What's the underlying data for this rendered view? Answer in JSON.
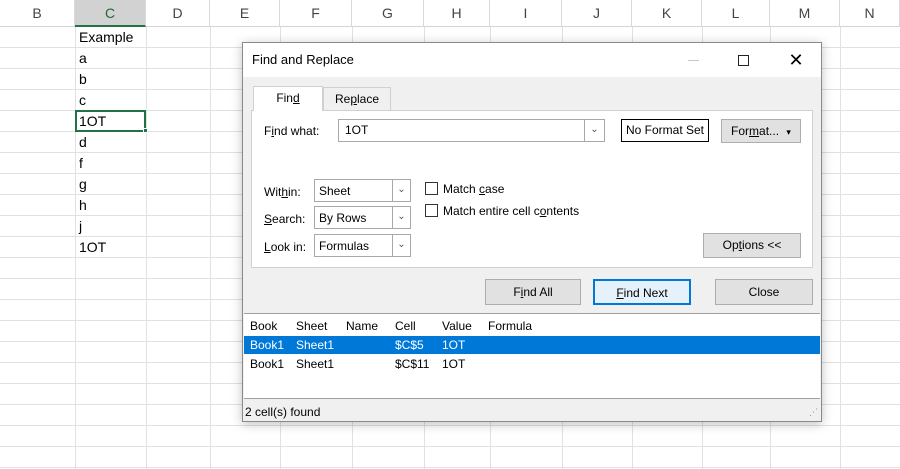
{
  "sheet": {
    "columns": [
      "B",
      "C",
      "D",
      "E",
      "F",
      "G",
      "H",
      "I",
      "J",
      "K",
      "L",
      "M",
      "N"
    ],
    "selected_column": "C",
    "cells": [
      "Example",
      "a",
      "b",
      "c",
      "1OT",
      "d",
      "f",
      "g",
      "h",
      "j",
      "1OT"
    ]
  },
  "dialog": {
    "title": "Find and Replace",
    "tabs": {
      "find": {
        "pre": "Fin",
        "acc": "d",
        "post": ""
      },
      "replace": {
        "pre": "Re",
        "acc": "p",
        "post": "lace"
      }
    },
    "find_what_label": {
      "pre": "F",
      "acc": "i",
      "post": "nd what:"
    },
    "find_what_value": "1OT",
    "no_format_text": "No Format Set",
    "format_button": {
      "pre": "For",
      "acc": "m",
      "post": "at...",
      "arrow": "▾"
    },
    "within": {
      "label_pre": "Wit",
      "label_acc": "h",
      "label_post": "in:",
      "value": "Sheet"
    },
    "search": {
      "label_pre": "",
      "label_acc": "S",
      "label_post": "earch:",
      "value": "By Rows"
    },
    "look_in": {
      "label_pre": "",
      "label_acc": "L",
      "label_post": "ook in:",
      "value": "Formulas"
    },
    "match_case": {
      "pre": "Match ",
      "acc": "c",
      "post": "ase",
      "checked": false
    },
    "match_entire": {
      "pre": "Match entire cell c",
      "acc": "o",
      "post": "ntents",
      "checked": false
    },
    "options_button": {
      "pre": "Op",
      "acc": "t",
      "post": "ions <<"
    },
    "find_all_button": {
      "pre": "F",
      "acc": "i",
      "post": "nd All"
    },
    "find_next_button": {
      "pre": "",
      "acc": "F",
      "post": "ind Next"
    },
    "close_button": "Close",
    "results": {
      "headers": [
        "Book",
        "Sheet",
        "Name",
        "Cell",
        "Value",
        "Formula"
      ],
      "rows": [
        [
          "Book1",
          "Sheet1",
          "",
          "$C$5",
          "1OT",
          ""
        ],
        [
          "Book1",
          "Sheet1",
          "",
          "$C$11",
          "1OT",
          ""
        ]
      ],
      "selected_row": 0
    },
    "status": "2 cell(s) found",
    "icons": {
      "close": "close-icon",
      "maximize": "maximize-icon",
      "minimize": "minimize-icon",
      "dropdown": "chevron-down-icon"
    },
    "colors": {
      "accent": "#0078d7",
      "excel_green": "#217346"
    }
  }
}
